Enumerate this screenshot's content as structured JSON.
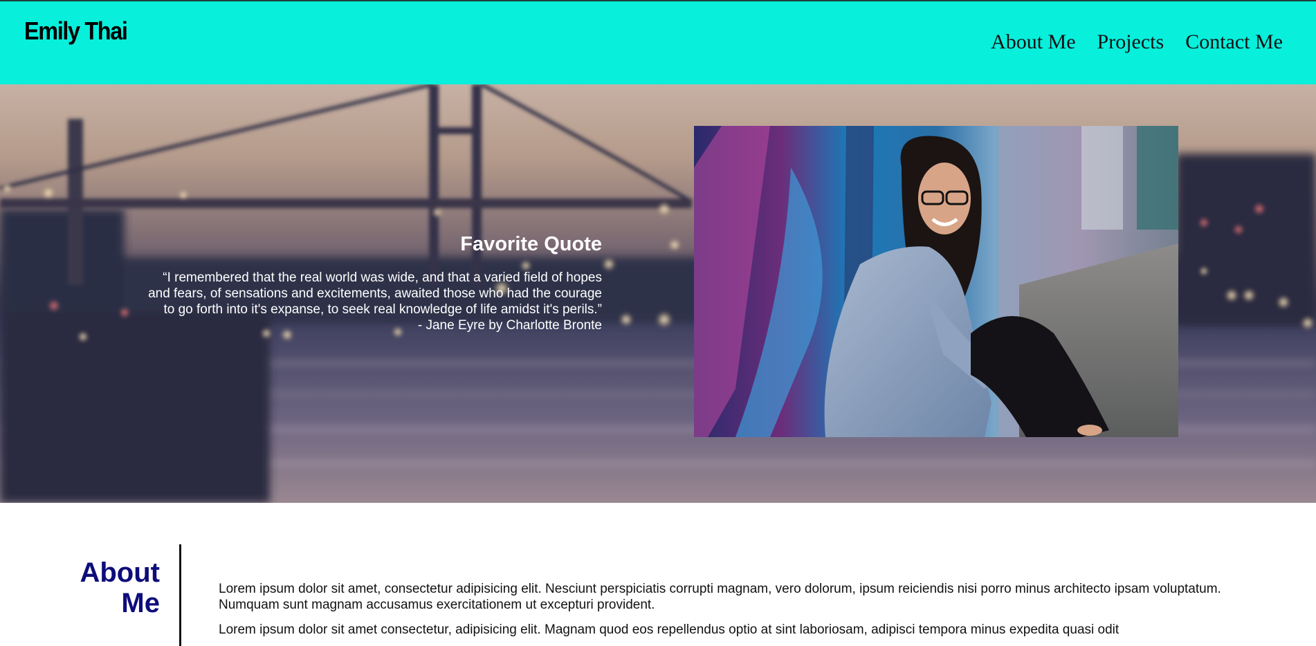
{
  "header": {
    "brand": "Emily Thai",
    "nav": [
      "About Me",
      "Projects",
      "Contact Me"
    ]
  },
  "hero": {
    "quote_title": "Favorite Quote",
    "quote_text": "“I remembered that the real world was wide, and that a varied field of hopes and fears, of sensations and excitements, awaited those who had the courage to go forth into it's expanse, to seek real knowledge of life amidst it's perils.”",
    "quote_author": "- Jane Eyre by Charlotte Bronte"
  },
  "about": {
    "heading_line1": "About",
    "heading_line2": "Me",
    "paragraph1": "Lorem ipsum dolor sit amet, consectetur adipisicing elit. Nesciunt perspiciatis corrupti magnam, vero dolorum, ipsum reiciendis nisi porro minus architecto ipsam voluptatum. Numquam sunt magnam accusamus exercitationem ut excepturi provident.",
    "paragraph2": "Lorem ipsum dolor sit amet consectetur, adipisicing elit. Magnam quod eos repellendus optio at sint laboriosam, adipisci tempora minus expedita quasi odit"
  },
  "colors": {
    "header_bg": "#08efdc",
    "about_heading": "#0d0d7a"
  }
}
